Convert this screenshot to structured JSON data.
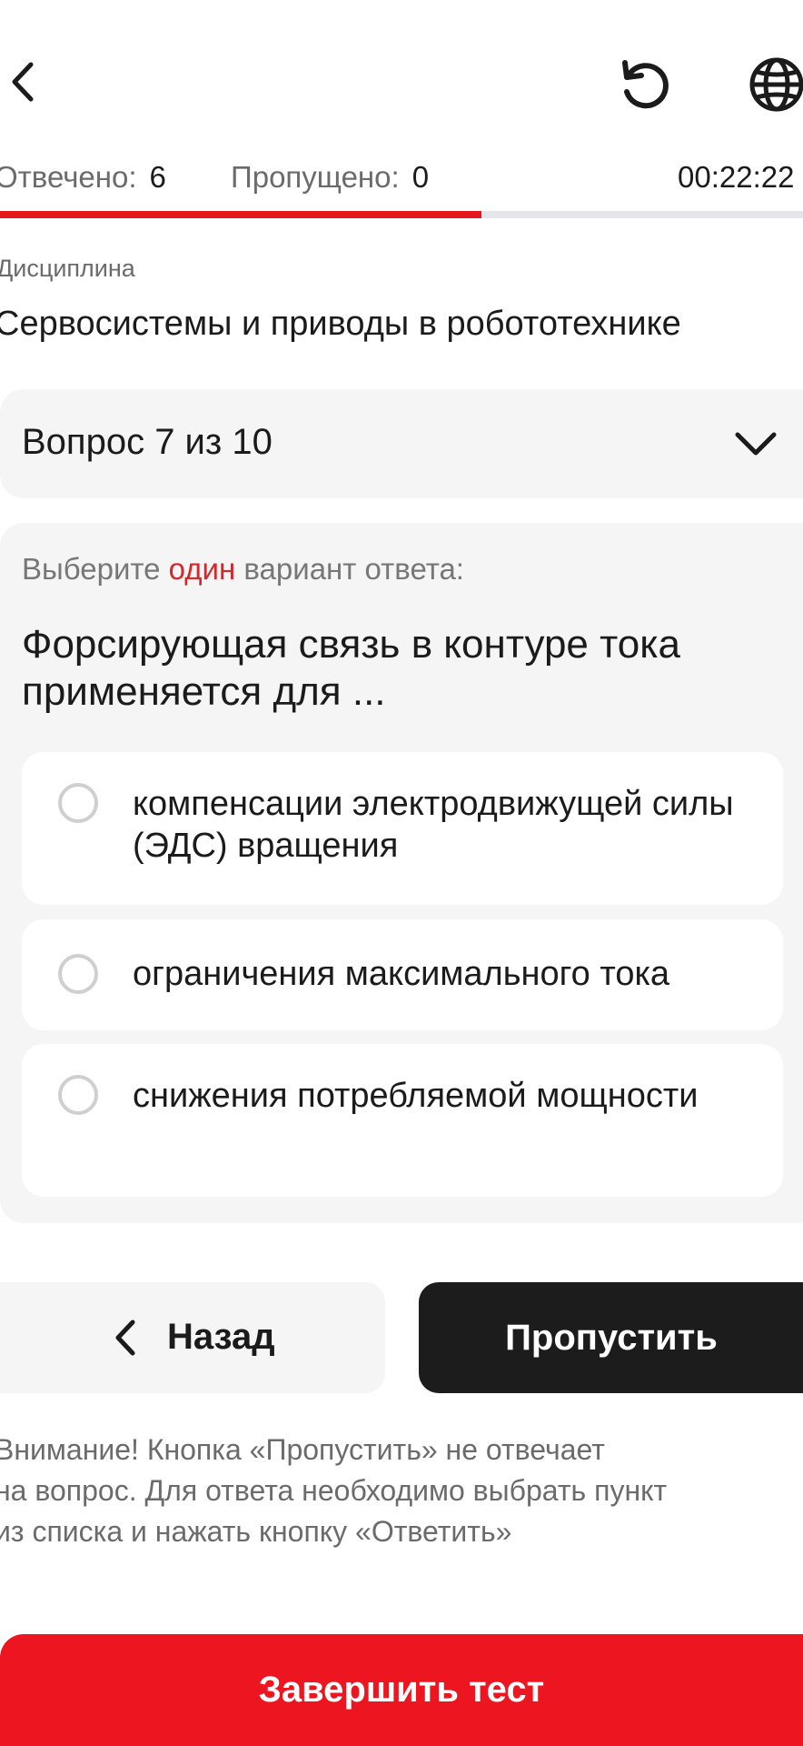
{
  "header": {
    "back_icon": "chevron-left-icon",
    "reset_icon": "reset-icon",
    "language_icon": "globe-icon"
  },
  "stats": {
    "answered_label": "Отвечено:",
    "answered_value": "6",
    "skipped_label": "Пропущено:",
    "skipped_value": "0",
    "timer": "00:22:22"
  },
  "progress": {
    "fraction": 0.6,
    "color": "#e5161c"
  },
  "discipline": {
    "label": "Дисциплина",
    "name": "Сервосистемы и приводы в робототехнике"
  },
  "question_selector": {
    "label": "Вопрос 7 из 10"
  },
  "question": {
    "instruction_before": "Выберите ",
    "instruction_accent": "один",
    "instruction_after": " вариант ответа:",
    "text": "Форсирующая связь в контуре тока применяется для ...",
    "options": [
      {
        "label": "компенсации электродвижущей силы (ЭДС) вращения"
      },
      {
        "label": "ограничения максимального тока"
      },
      {
        "label": "снижения потребляемой мощности"
      }
    ]
  },
  "nav": {
    "back_label": "Назад",
    "skip_label": "Пропустить"
  },
  "warning": {
    "line1": "Внимание! Кнопка «Пропустить» не отвечает",
    "line2": "на вопрос. Для ответа необходимо выбрать пункт",
    "line3": "из списка и нажать кнопку «Ответить»"
  },
  "finish": {
    "label": "Завершить тест"
  },
  "colors": {
    "accent_red": "#ec1520",
    "dark_button": "#1c1c1c",
    "card_bg": "#f5f5f5"
  }
}
